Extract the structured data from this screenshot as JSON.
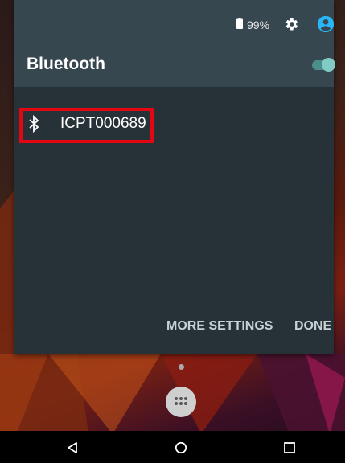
{
  "status_bar": {
    "battery_percent": "99%",
    "icons": [
      "battery-icon",
      "gear-icon",
      "account-icon"
    ]
  },
  "header": {
    "title": "Bluetooth",
    "toggle_on": true
  },
  "devices": [
    {
      "name": "ICPT000689",
      "icon": "bluetooth-icon",
      "highlighted": true
    }
  ],
  "actions": {
    "more_settings": "MORE SETTINGS",
    "done": "DONE"
  },
  "nav_bar": {
    "icons": [
      "back-icon",
      "home-icon",
      "recents-icon"
    ]
  },
  "colors": {
    "panel_bg": "#263238",
    "header_bg": "#37474f",
    "toggle_accent": "#80cbc4",
    "account_accent": "#29b6f6",
    "highlight": "#e30613"
  }
}
